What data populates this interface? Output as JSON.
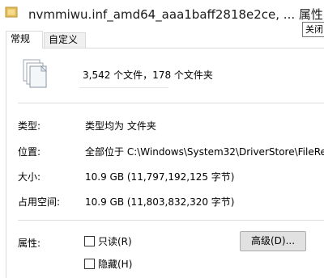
{
  "window": {
    "title": "nvmmiwu.inf_amd64_aaa1baff2818e2ce, ... 属性",
    "tooltip": "关闭"
  },
  "tabs": [
    {
      "label": "常规",
      "active": true
    },
    {
      "label": "自定义",
      "active": false
    }
  ],
  "summary": {
    "name_text": "3,542 个文件，178 个文件夹"
  },
  "properties": [
    {
      "label": "类型:",
      "value": "类型均为 文件夹"
    },
    {
      "label": "位置:",
      "value": "全部位于 C:\\Windows\\System32\\DriverStore\\FileRe"
    },
    {
      "label": "大小:",
      "value": "10.9 GB (11,797,192,125 字节)"
    },
    {
      "label": "占用空间:",
      "value": "10.9 GB (11,803,832,320 字节)"
    }
  ],
  "attributes": {
    "label": "属性:",
    "readonly_label": "只读(R)",
    "hidden_label": "隐藏(H)",
    "advanced_button": "高级(D)..."
  },
  "icons": {
    "title_icon": "folder-stack-icon",
    "file_icon": "multiple-files-icon"
  }
}
